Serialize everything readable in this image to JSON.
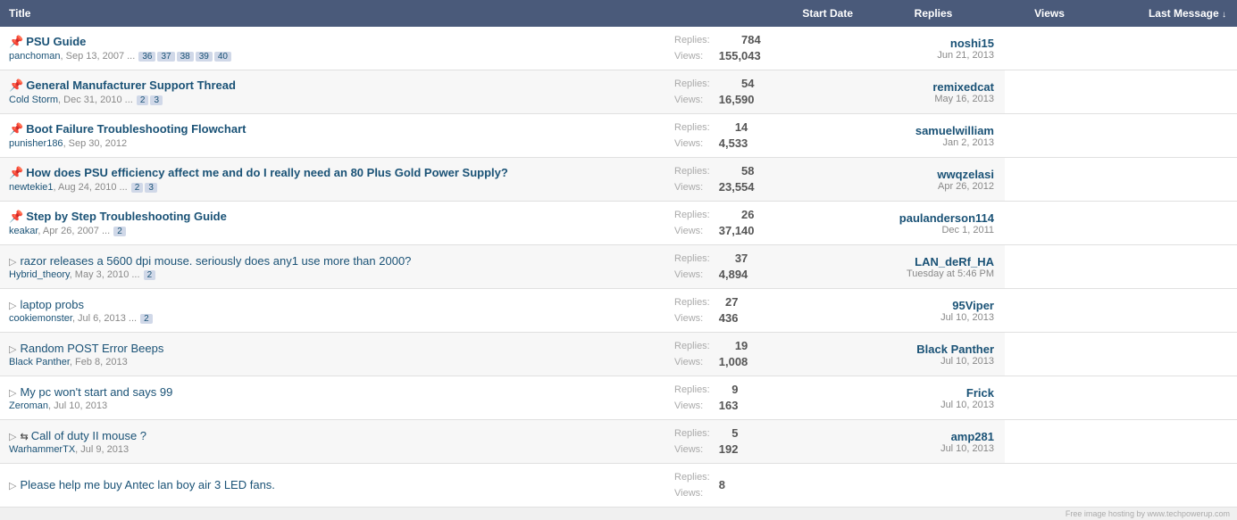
{
  "table": {
    "headers": {
      "title": "Title",
      "start_date": "Start Date",
      "replies": "Replies",
      "views": "Views",
      "last_message": "Last Message"
    },
    "threads": [
      {
        "id": 1,
        "sticky": true,
        "hot": false,
        "has_arrow": false,
        "title": "PSU Guide",
        "title_color": "blue",
        "author": "panchoman",
        "date": "Sep 13, 2007",
        "pages": [
          "36",
          "37",
          "38",
          "39",
          "40"
        ],
        "replies_label": "Replies:",
        "views_label": "Views:",
        "replies": "784",
        "views": "155,043",
        "last_user": "noshi15",
        "last_user_bold": false,
        "last_date": "Jun 21, 2013"
      },
      {
        "id": 2,
        "sticky": true,
        "hot": false,
        "has_arrow": false,
        "title": "General Manufacturer Support Thread",
        "title_color": "blue",
        "author": "Cold Storm",
        "date": "Dec 31, 2010",
        "pages": [
          "2",
          "3"
        ],
        "replies_label": "Replies:",
        "views_label": "Views:",
        "replies": "54",
        "views": "16,590",
        "last_user": "remixedcat",
        "last_user_bold": false,
        "last_date": "May 16, 2013"
      },
      {
        "id": 3,
        "sticky": true,
        "hot": false,
        "has_arrow": false,
        "title": "Boot Failure Troubleshooting Flowchart",
        "title_color": "blue",
        "author": "punisher186",
        "date": "Sep 30, 2012",
        "pages": [],
        "replies_label": "Replies:",
        "views_label": "Views:",
        "replies": "14",
        "views": "4,533",
        "last_user": "samuelwilliam",
        "last_user_bold": false,
        "last_date": "Jan 2, 2013"
      },
      {
        "id": 4,
        "sticky": true,
        "hot": true,
        "has_arrow": false,
        "title": "How does PSU efficiency affect me and do I really need an 80 Plus Gold Power Supply?",
        "title_color": "blue",
        "author": "newtekie1",
        "date": "Aug 24, 2010",
        "pages": [
          "2",
          "3"
        ],
        "replies_label": "Replies:",
        "views_label": "Views:",
        "replies": "58",
        "views": "23,554",
        "last_user": "wwqzelasi",
        "last_user_bold": false,
        "last_date": "Apr 26, 2012"
      },
      {
        "id": 5,
        "sticky": true,
        "hot": false,
        "has_arrow": false,
        "title": "Step by Step Troubleshooting Guide",
        "title_color": "blue",
        "author": "keakar",
        "date": "Apr 26, 2007",
        "pages": [
          "2"
        ],
        "replies_label": "Replies:",
        "views_label": "Views:",
        "replies": "26",
        "views": "37,140",
        "last_user": "paulanderson114",
        "last_user_bold": false,
        "last_date": "Dec 1, 2011"
      },
      {
        "id": 6,
        "sticky": false,
        "hot": false,
        "has_arrow": true,
        "title": "razor releases a 5600 dpi mouse. seriously does any1 use more than 2000?",
        "title_color": "blue",
        "author": "Hybrid_theory",
        "date": "May 3, 2010",
        "pages": [
          "2"
        ],
        "replies_label": "Replies:",
        "views_label": "Views:",
        "replies": "37",
        "views": "4,894",
        "last_user": "LAN_deRf_HA",
        "last_user_bold": true,
        "last_date": "Tuesday at 5:46 PM"
      },
      {
        "id": 7,
        "sticky": false,
        "hot": false,
        "has_arrow": true,
        "title": "laptop probs",
        "title_color": "blue",
        "author": "cookiemonster",
        "date": "Jul 6, 2013",
        "pages": [
          "2"
        ],
        "replies_label": "Replies:",
        "views_label": "Views:",
        "replies": "27",
        "views": "436",
        "last_user": "95Viper",
        "last_user_bold": true,
        "last_date": "Jul 10, 2013"
      },
      {
        "id": 8,
        "sticky": false,
        "hot": false,
        "has_arrow": true,
        "title": "Random POST Error Beeps",
        "title_color": "blue",
        "author": "Black Panther",
        "date": "Feb 8, 2013",
        "pages": [],
        "replies_label": "Replies:",
        "views_label": "Views:",
        "replies": "19",
        "views": "1,008",
        "last_user": "Black Panther",
        "last_user_bold": true,
        "last_date": "Jul 10, 2013"
      },
      {
        "id": 9,
        "sticky": false,
        "hot": false,
        "has_arrow": true,
        "title": "My pc won't start and says 99",
        "title_color": "blue",
        "author": "Zeroman",
        "date": "Jul 10, 2013",
        "pages": [],
        "replies_label": "Replies:",
        "views_label": "Views:",
        "replies": "9",
        "views": "163",
        "last_user": "Frick",
        "last_user_bold": true,
        "last_date": "Jul 10, 2013"
      },
      {
        "id": 10,
        "sticky": false,
        "hot": false,
        "has_arrow": true,
        "has_redirect": true,
        "title": "Call of duty II mouse ?",
        "title_color": "blue",
        "author": "WarhammerTX",
        "date": "Jul 9, 2013",
        "pages": [],
        "replies_label": "Replies:",
        "views_label": "Views:",
        "replies": "5",
        "views": "192",
        "last_user": "amp281",
        "last_user_bold": true,
        "last_date": "Jul 10, 2013"
      },
      {
        "id": 11,
        "sticky": false,
        "hot": false,
        "has_arrow": true,
        "title": "Please help me buy Antec lan boy air 3 LED fans.",
        "title_color": "blue",
        "author": "",
        "date": "",
        "pages": [],
        "replies_label": "Replies:",
        "views_label": "Views:",
        "replies": "8",
        "views": "",
        "last_user": "",
        "last_user_bold": false,
        "last_date": ""
      }
    ],
    "watermark": "Free image hosting by www.techpowerup.com"
  }
}
